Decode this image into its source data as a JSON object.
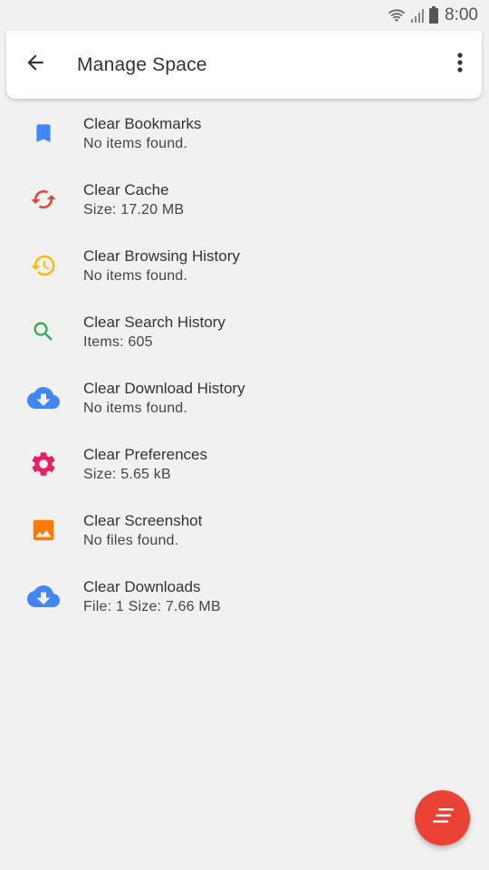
{
  "status_bar": {
    "time": "8:00",
    "icons": [
      "wifi-icon",
      "signal-icon",
      "battery-icon"
    ]
  },
  "app_bar": {
    "title": "Manage Space",
    "back_icon": "arrow-back-icon",
    "menu_icon": "more-vert-icon"
  },
  "items": [
    {
      "title": "Clear Bookmarks",
      "subtitle": "No items found.",
      "icon": "bookmark-icon",
      "color": "#4285f4"
    },
    {
      "title": "Clear Cache",
      "subtitle": "Size: 17.20 MB",
      "icon": "cached-icon",
      "color": "#ea4335"
    },
    {
      "title": "Clear Browsing History",
      "subtitle": "No items found.",
      "icon": "history-icon",
      "color": "#fbbc05"
    },
    {
      "title": "Clear Search History",
      "subtitle": "Items: 605",
      "icon": "search-icon",
      "color": "#34a853"
    },
    {
      "title": "Clear Download History",
      "subtitle": "No items found.",
      "icon": "cloud-download-icon",
      "color": "#4285f4"
    },
    {
      "title": "Clear Preferences",
      "subtitle": "Size: 5.65 kB",
      "icon": "settings-icon",
      "color": "#e91e63"
    },
    {
      "title": "Clear Screenshot",
      "subtitle": "No files found.",
      "icon": "image-icon",
      "color": "#ff7a00"
    },
    {
      "title": "Clear Downloads",
      "subtitle": "File: 1 Size: 7.66 MB",
      "icon": "cloud-download-icon",
      "color": "#4285f4"
    }
  ],
  "fab": {
    "icon": "clear-all-icon",
    "color": "#ea4335"
  }
}
